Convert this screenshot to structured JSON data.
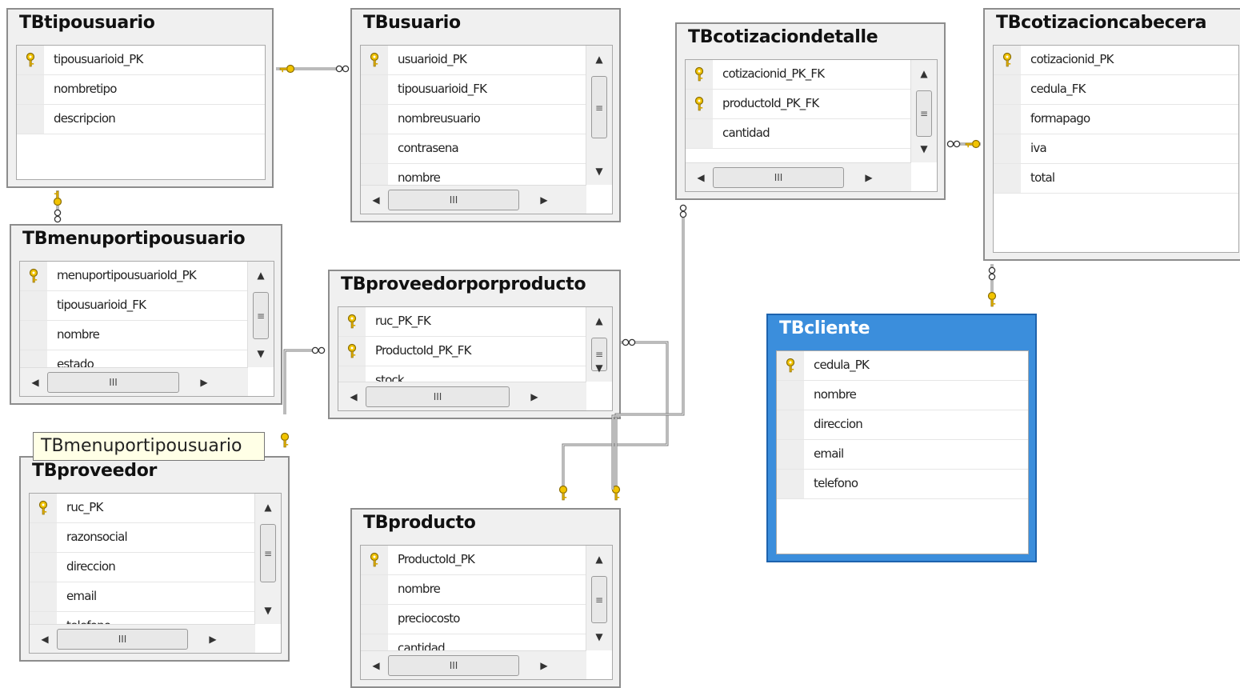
{
  "tables": {
    "tipousuario": {
      "title": "TBtipousuario",
      "cols": [
        {
          "name": "tipousuarioid_PK",
          "pk": true
        },
        {
          "name": "nombretipo",
          "pk": false
        },
        {
          "name": "descripcion",
          "pk": false
        }
      ]
    },
    "usuario": {
      "title": "TBusuario",
      "cols": [
        {
          "name": "usuarioid_PK",
          "pk": true
        },
        {
          "name": "tipousuarioid_FK",
          "pk": false
        },
        {
          "name": "nombreusuario",
          "pk": false
        },
        {
          "name": "contrasena",
          "pk": false
        },
        {
          "name": "nombre",
          "pk": false
        }
      ]
    },
    "cotizaciondetalle": {
      "title": "TBcotizaciondetalle",
      "cols": [
        {
          "name": "cotizacionid_PK_FK",
          "pk": true
        },
        {
          "name": "productoId_PK_FK",
          "pk": true
        },
        {
          "name": "cantidad",
          "pk": false
        }
      ]
    },
    "cotizacioncabecera": {
      "title": "TBcotizacioncabecera",
      "cols": [
        {
          "name": "cotizacionid_PK",
          "pk": true
        },
        {
          "name": "cedula_FK",
          "pk": false
        },
        {
          "name": "formapago",
          "pk": false
        },
        {
          "name": "iva",
          "pk": false
        },
        {
          "name": "total",
          "pk": false
        }
      ]
    },
    "menuportipousuario": {
      "title": "TBmenuportipousuario",
      "cols": [
        {
          "name": "menuportipousuarioId_PK",
          "pk": true
        },
        {
          "name": "tipousuarioid_FK",
          "pk": false
        },
        {
          "name": "nombre",
          "pk": false
        },
        {
          "name": "estado",
          "pk": false
        }
      ]
    },
    "proveedorporproducto": {
      "title": "TBproveedorporproducto",
      "cols": [
        {
          "name": "ruc_PK_FK",
          "pk": true
        },
        {
          "name": "ProductoId_PK_FK",
          "pk": true
        },
        {
          "name": "stock",
          "pk": false
        }
      ]
    },
    "cliente": {
      "title": "TBcliente",
      "cols": [
        {
          "name": "cedula_PK",
          "pk": true
        },
        {
          "name": "nombre",
          "pk": false
        },
        {
          "name": "direccion",
          "pk": false
        },
        {
          "name": "email",
          "pk": false
        },
        {
          "name": "telefono",
          "pk": false
        }
      ]
    },
    "proveedor": {
      "title": "TBproveedor",
      "cols": [
        {
          "name": "ruc_PK",
          "pk": true
        },
        {
          "name": "razonsocial",
          "pk": false
        },
        {
          "name": "direccion",
          "pk": false
        },
        {
          "name": "email",
          "pk": false
        },
        {
          "name": "telefono",
          "pk": false
        }
      ]
    },
    "producto": {
      "title": "TBproducto",
      "cols": [
        {
          "name": "ProductoId_PK",
          "pk": true
        },
        {
          "name": "nombre",
          "pk": false
        },
        {
          "name": "preciocosto",
          "pk": false
        },
        {
          "name": "cantidad",
          "pk": false
        }
      ]
    }
  },
  "tooltip": "TBmenuportipousuario",
  "selected_table": "TBcliente",
  "icons": {
    "key": "key-icon",
    "infinity": "many-relationship-icon"
  },
  "colors": {
    "selected_header": "#3b8edc",
    "key": "#f2c400",
    "line": "#7a7a7a"
  }
}
